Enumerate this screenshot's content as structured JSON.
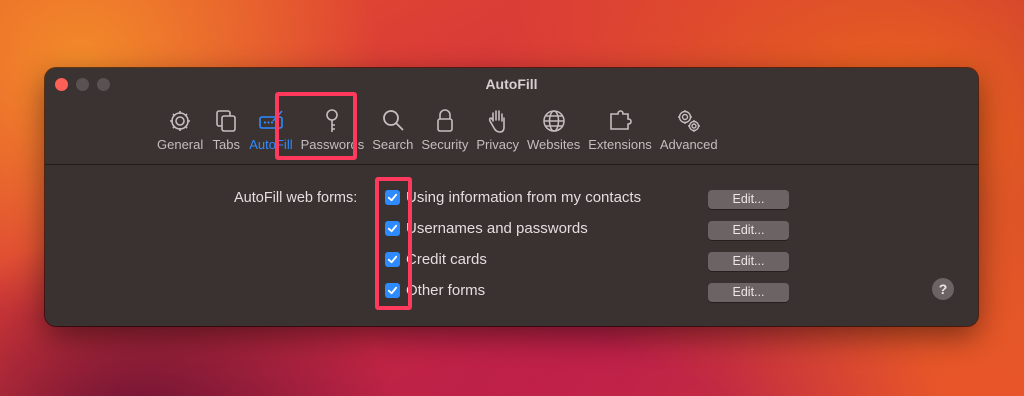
{
  "window": {
    "title": "AutoFill"
  },
  "toolbar": {
    "tabs": [
      {
        "label": "General",
        "icon": "gear-icon"
      },
      {
        "label": "Tabs",
        "icon": "tabs-icon"
      },
      {
        "label": "AutoFill",
        "icon": "autofill-icon",
        "active": true
      },
      {
        "label": "Passwords",
        "icon": "key-icon"
      },
      {
        "label": "Search",
        "icon": "search-icon"
      },
      {
        "label": "Security",
        "icon": "lock-icon"
      },
      {
        "label": "Privacy",
        "icon": "hand-icon"
      },
      {
        "label": "Websites",
        "icon": "globe-icon"
      },
      {
        "label": "Extensions",
        "icon": "puzzle-icon"
      },
      {
        "label": "Advanced",
        "icon": "gears-icon"
      }
    ]
  },
  "autofill": {
    "section_label": "AutoFill web forms:",
    "options": [
      {
        "label": "Using information from my contacts",
        "checked": true,
        "edit_label": "Edit..."
      },
      {
        "label": "Usernames and passwords",
        "checked": true,
        "edit_label": "Edit..."
      },
      {
        "label": "Credit cards",
        "checked": true,
        "edit_label": "Edit..."
      },
      {
        "label": "Other forms",
        "checked": true,
        "edit_label": "Edit..."
      }
    ]
  },
  "help": {
    "label": "?"
  },
  "colors": {
    "accent": "#2e8bff",
    "highlight": "#ff3a5c",
    "window_bg": "#3a3131"
  }
}
